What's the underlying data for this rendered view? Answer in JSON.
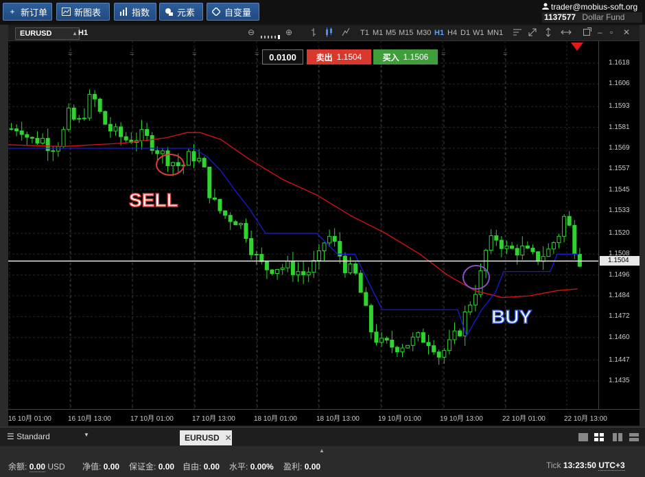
{
  "toolbar": {
    "new_order": "新订单",
    "new_chart": "新图表",
    "indicators": "指数",
    "elements": "元素",
    "custom_vars": "自变量"
  },
  "account": {
    "user": "trader@mobius-soft.org",
    "number": "1137577",
    "name": "Dollar Fund"
  },
  "chart_header": {
    "symbol": "EURUSD",
    "period": "H1",
    "timeframes": [
      "T1",
      "M1",
      "M5",
      "M15",
      "M30",
      "H1",
      "H4",
      "D1",
      "W1",
      "MN1"
    ],
    "active_timeframe": "H1"
  },
  "trade_panel": {
    "lot": "0.0100",
    "sell_label": "卖出",
    "sell_price": "1.1504",
    "buy_label": "买入",
    "buy_price": "1.1506"
  },
  "annotations": {
    "sell": "SELL",
    "buy": "BUY"
  },
  "price_axis": {
    "ticks": [
      "1.1618",
      "1.1606",
      "1.1593",
      "1.1581",
      "1.1569",
      "1.1557",
      "1.1545",
      "1.1533",
      "1.1520",
      "1.1508",
      "1.1496",
      "1.1484",
      "1.1472",
      "1.1460",
      "1.1447",
      "1.1435"
    ],
    "current": "1.1504"
  },
  "time_axis": {
    "ticks": [
      "16 10月 01:00",
      "16 10月 13:00",
      "17 10月 01:00",
      "17 10月 13:00",
      "18 10月 01:00",
      "18 10月 13:00",
      "19 10月 01:00",
      "19 10月 13:00",
      "22 10月 01:00",
      "22 10月 13:00"
    ]
  },
  "tabs": {
    "profile": "Standard",
    "active_tab": "EURUSD"
  },
  "status": {
    "balance_label": "余额:",
    "balance_value": "0.00",
    "balance_ccy": "USD",
    "equity_label": "净值:",
    "equity_value": "0.00",
    "margin_label": "保证金:",
    "margin_value": "0.00",
    "free_label": "自由:",
    "free_value": "0.00",
    "level_label": "水平:",
    "level_value": "0.00%",
    "profit_label": "盈利:",
    "profit_value": "0.00",
    "tick_label": "Tick",
    "time": "13:23:50",
    "tz": "UTC+3"
  },
  "colors": {
    "up_candle": "#2fd42f",
    "down_candle": "#2fd42f",
    "ma_red": "#e01010",
    "ma_blue": "#1a1adb",
    "current_line": "#e8e8e8",
    "sell_circle": "#e03a3a",
    "buy_circle": "#8a4fc9"
  }
}
